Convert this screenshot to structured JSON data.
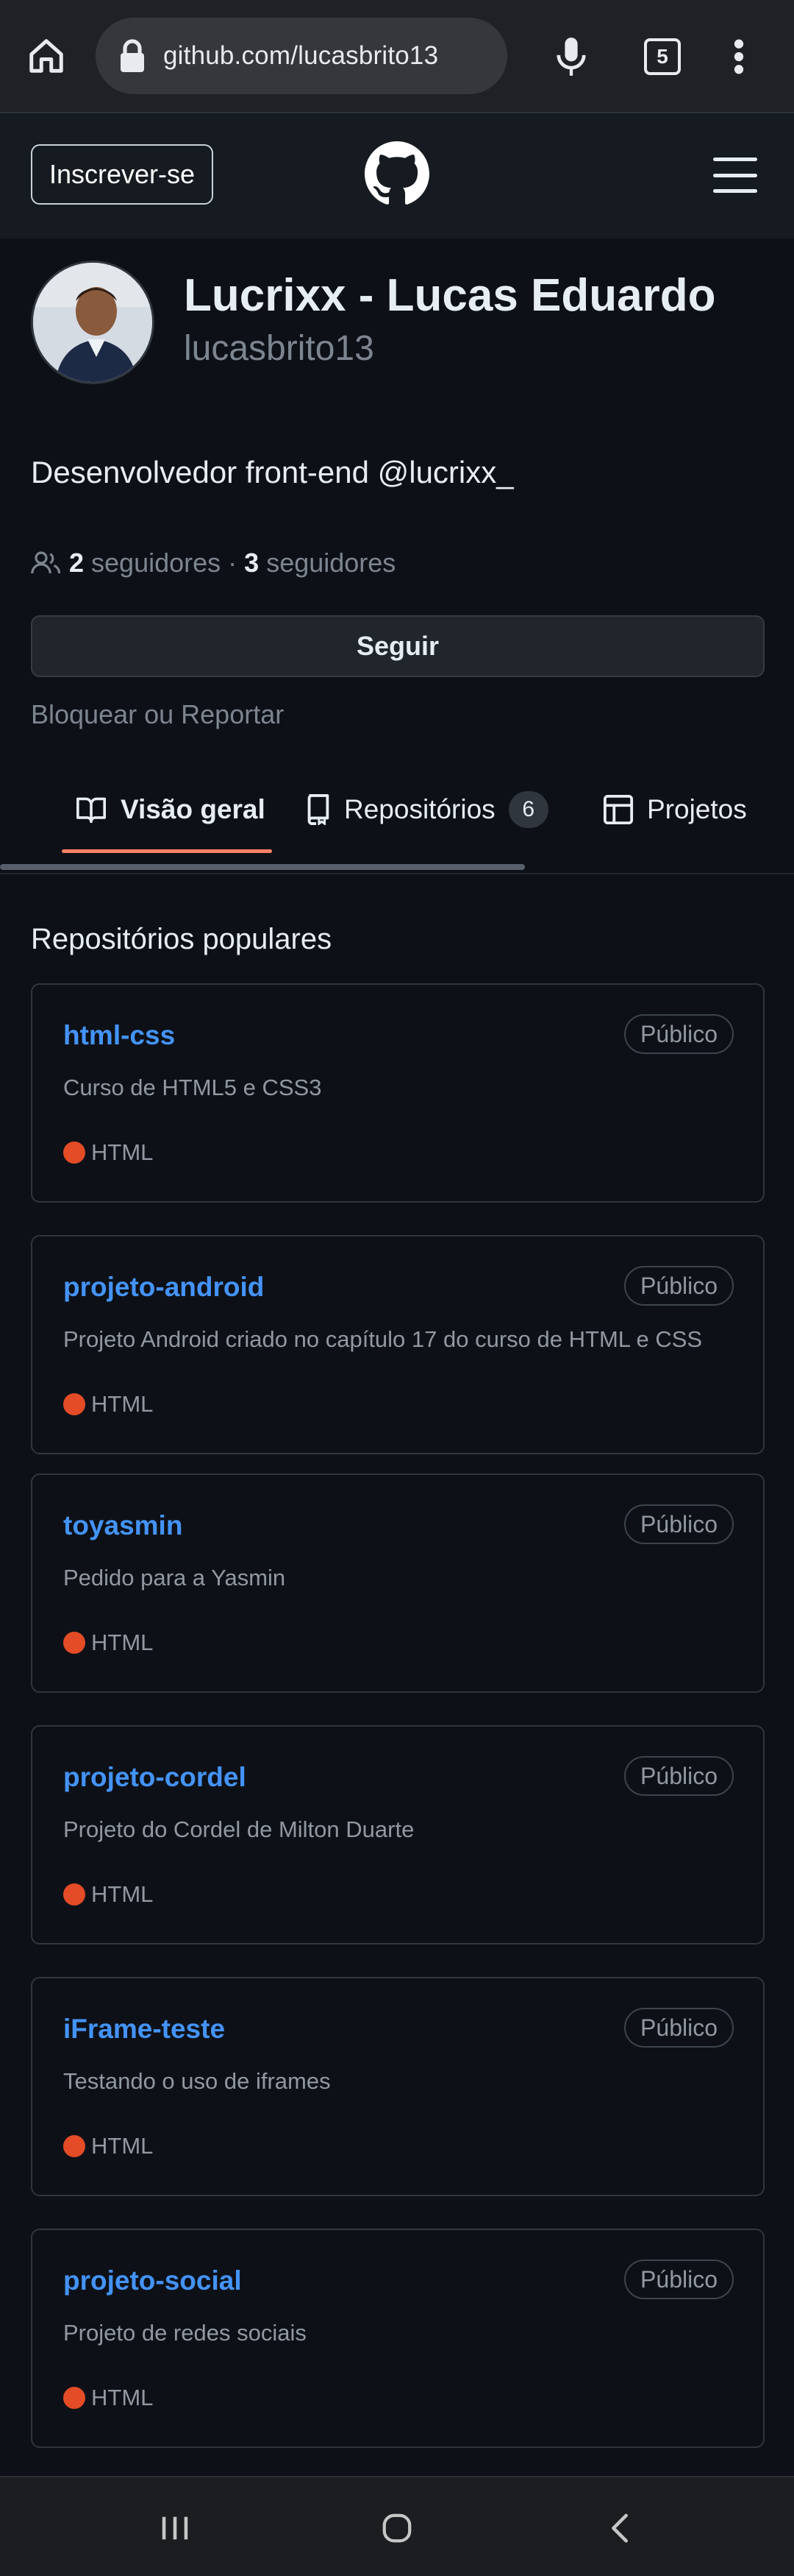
{
  "browser": {
    "url": "github.com/lucasbrito13",
    "tab_count": "5",
    "icons": [
      "home-icon",
      "lock-icon",
      "mic-icon",
      "tabs-icon",
      "more-vert-icon"
    ]
  },
  "header": {
    "signup_label": "Inscrever-se",
    "logo": "github-mark-icon",
    "menu_icon": "hamburger-icon"
  },
  "profile": {
    "display_name": "Lucrixx - Lucas Eduardo",
    "username": "lucasbrito13",
    "bio": "Desenvolvedor front-end @lucrixx_",
    "followers_count": "2",
    "followers_label": "seguidores",
    "separator": "·",
    "following_count": "3",
    "following_label": "seguidores",
    "follow_label": "Seguir",
    "block_label": "Bloquear ou Reportar"
  },
  "tabs": [
    {
      "label": "Visão geral",
      "icon": "book-icon",
      "selected": true
    },
    {
      "label": "Repositórios",
      "icon": "repo-icon",
      "count": "6"
    },
    {
      "label": "Projetos",
      "icon": "table-icon"
    }
  ],
  "popular": {
    "title": "Repositórios populares",
    "repos": [
      {
        "name": "html-css",
        "visibility": "Público",
        "description": "Curso de HTML5 e CSS3",
        "language": "HTML"
      },
      {
        "name": "projeto-android",
        "visibility": "Público",
        "description": "Projeto Android criado no capítulo 17 do curso de HTML e CSS",
        "language": "HTML"
      },
      {
        "name": "toyasmin",
        "visibility": "Público",
        "description": "Pedido para a Yasmin",
        "language": "HTML"
      },
      {
        "name": "projeto-cordel",
        "visibility": "Público",
        "description": "Projeto do Cordel de Milton Duarte",
        "language": "HTML"
      },
      {
        "name": "iFrame-teste",
        "visibility": "Público",
        "description": "Testando o uso de iframes",
        "language": "HTML"
      },
      {
        "name": "projeto-social",
        "visibility": "Público",
        "description": "Projeto de redes sociais",
        "language": "HTML"
      }
    ]
  },
  "colors": {
    "background": "#0d1117",
    "link": "#4493f8",
    "tab_underline": "#f78166",
    "html_language": "#e34c26"
  },
  "android_nav": [
    "recents-icon",
    "home-circle-icon",
    "back-icon"
  ]
}
